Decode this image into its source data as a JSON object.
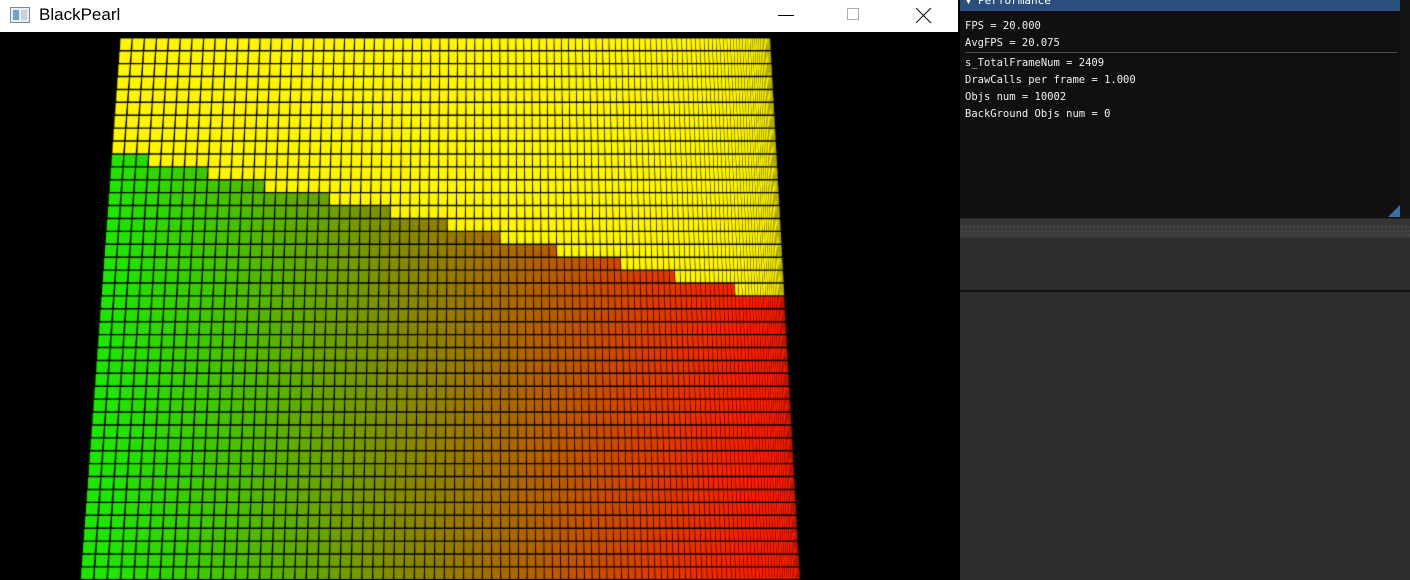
{
  "window": {
    "title": "BlackPearl",
    "minimize_label": "",
    "maximize_label": "",
    "close_label": ""
  },
  "viewport": {
    "description_icon": "cube-grid-render",
    "colors": {
      "top": "#ffff00",
      "left": "#00ff00",
      "right_bottom": "#ff2000",
      "background": "#000000"
    }
  },
  "performance_panel": {
    "title": "Performance",
    "collapse_icon": "▼",
    "lines": {
      "fps": "FPS = 20.000",
      "avg_fps": "AvgFPS = 20.075",
      "total_frame_num": "s_TotalFrameNum = 2409",
      "draw_calls": "DrawCalls per frame = 1.000",
      "objs_num": "Objs num = 10002",
      "bg_objs_num": "BackGround Objs num = 0"
    },
    "accent_color": "#2a4f7d"
  }
}
